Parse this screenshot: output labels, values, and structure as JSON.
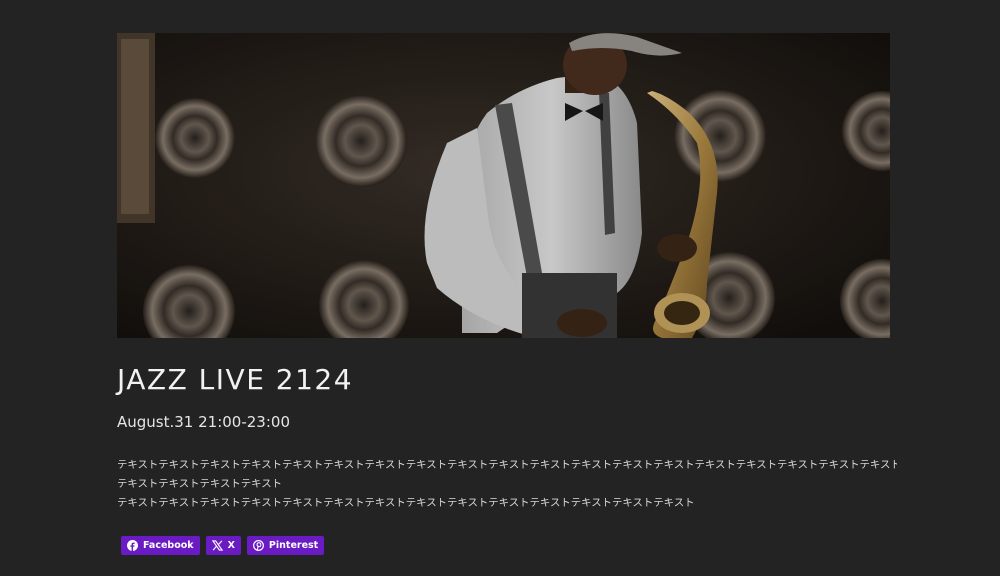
{
  "event": {
    "hero_image": "saxophone-player-photo",
    "title": "JAZZ LIVE 2124",
    "datetime": "August.31 21:00-23:00",
    "body_lines": [
      "テキストテキストテキストテキストテキストテキストテキストテキストテキストテキストテキストテキストテキストテキストテキストテキストテキストテキストテキストテキスト",
      "テキストテキストテキストテキスト",
      "テキストテキストテキストテキストテキストテキストテキストテキストテキストテキストテキストテキストテキストテキスト"
    ]
  },
  "share": {
    "buttons": [
      {
        "icon": "facebook-icon",
        "label": "Facebook"
      },
      {
        "icon": "x-icon",
        "label": "X"
      },
      {
        "icon": "pinterest-icon",
        "label": "Pinterest"
      }
    ],
    "color": "#6a1bc4"
  },
  "colors": {
    "background": "#232323",
    "text": "#eeeeee"
  }
}
